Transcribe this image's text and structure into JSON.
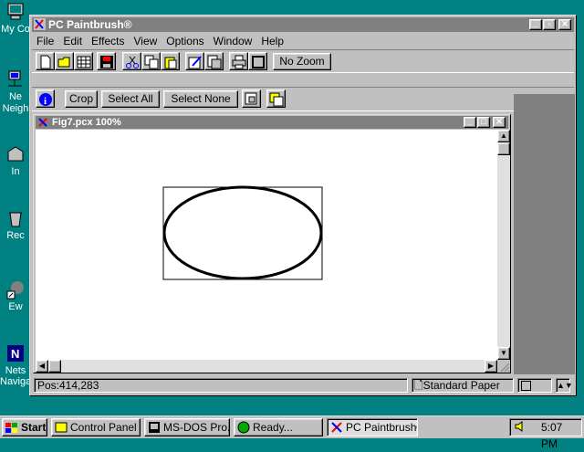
{
  "desktop": {
    "icons": [
      {
        "label": "My Co",
        "icon": "my-computer-icon"
      },
      {
        "label": "Ne\nNeigh",
        "icon": "network-neighborhood-icon"
      },
      {
        "label": "In",
        "icon": "inbox-icon"
      },
      {
        "label": "Rec",
        "icon": "recycle-bin-icon"
      },
      {
        "label": "Ew",
        "icon": "shortcut-icon"
      },
      {
        "label": "Nets\nNavigat",
        "icon": "netscape-navigator-icon"
      }
    ]
  },
  "app": {
    "title": "PC Paintbrush®",
    "menu": [
      "File",
      "Edit",
      "Effects",
      "View",
      "Options",
      "Window",
      "Help"
    ],
    "toolbar1": {
      "zoom_label": "No Zoom"
    },
    "toolbar2": {
      "crop": "Crop",
      "select_all": "Select All",
      "select_none": "Select None"
    },
    "document": {
      "title": "Fig7.pcx  100%"
    },
    "status": {
      "position": "Pos:414,283",
      "paper": "Standard Paper"
    }
  },
  "taskbar": {
    "start": "Start",
    "tasks": [
      "Control Panel",
      "MS-DOS Pro...",
      "Ready...",
      "PC Paintbrush®"
    ],
    "clock": "5:07 PM"
  },
  "colors": {
    "desktop": "#008080",
    "face": "#c0c0c0",
    "title_inactive": "#808080"
  }
}
